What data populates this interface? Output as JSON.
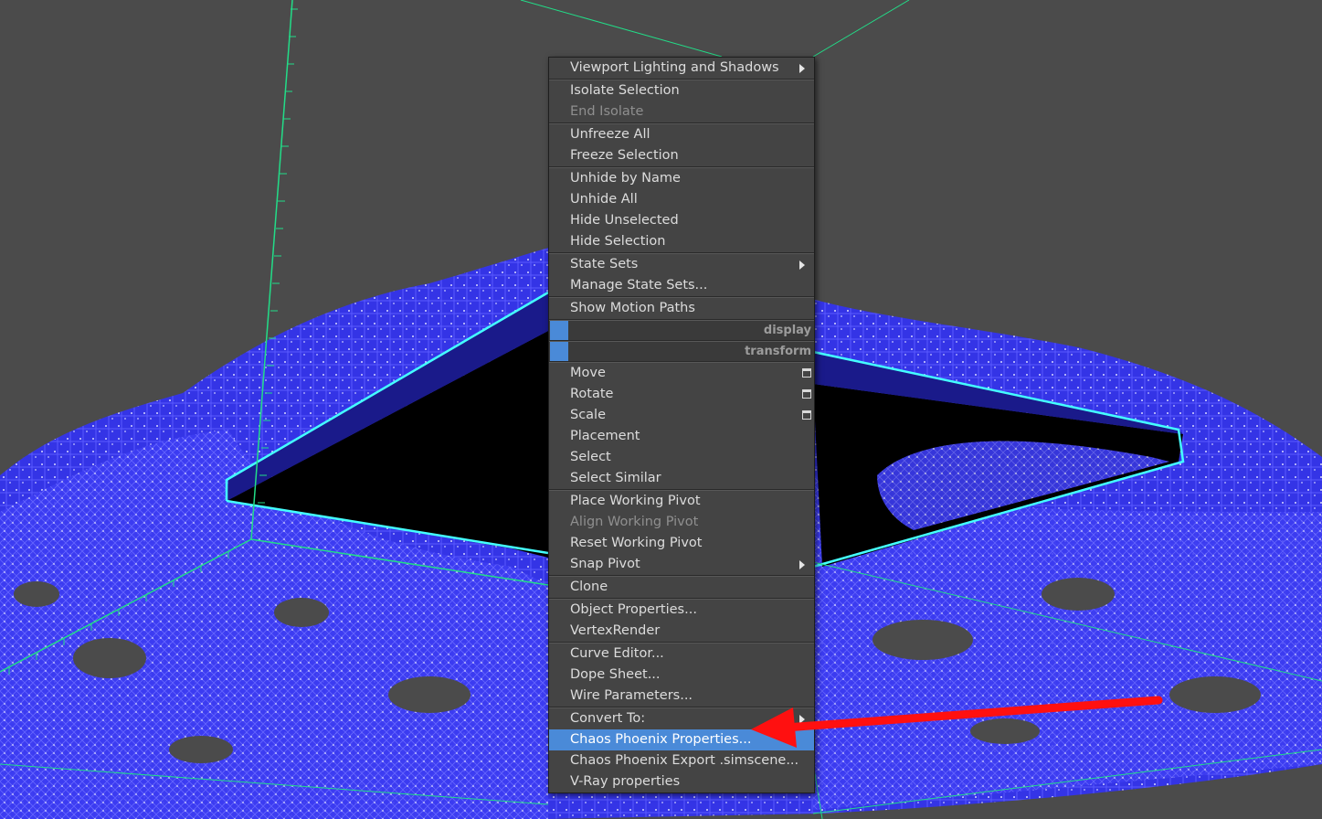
{
  "quad_menu": {
    "groups": [
      [
        {
          "label": "Viewport Lighting and Shadows",
          "submenu": true
        }
      ],
      [
        {
          "label": "Isolate Selection"
        },
        {
          "label": "End Isolate",
          "disabled": true
        }
      ],
      [
        {
          "label": "Unfreeze All"
        },
        {
          "label": "Freeze Selection"
        }
      ],
      [
        {
          "label": "Unhide by Name"
        },
        {
          "label": "Unhide All"
        },
        {
          "label": "Hide Unselected"
        },
        {
          "label": "Hide Selection"
        }
      ],
      [
        {
          "label": "State Sets",
          "submenu": true
        },
        {
          "label": "Manage State Sets..."
        }
      ],
      [
        {
          "label": "Show Motion Paths"
        }
      ]
    ],
    "quadrant_labels": [
      "display",
      "transform"
    ],
    "groups_after": [
      [
        {
          "label": "Move",
          "option_box": true
        },
        {
          "label": "Rotate",
          "option_box": true
        },
        {
          "label": "Scale",
          "option_box": true
        },
        {
          "label": "Placement"
        },
        {
          "label": "Select"
        },
        {
          "label": "Select Similar"
        }
      ],
      [
        {
          "label": "Place Working Pivot"
        },
        {
          "label": "Align Working Pivot",
          "disabled": true
        },
        {
          "label": "Reset Working Pivot"
        },
        {
          "label": "Snap Pivot",
          "submenu": true
        }
      ],
      [
        {
          "label": "Clone"
        }
      ],
      [
        {
          "label": "Object Properties..."
        },
        {
          "label": "VertexRender"
        }
      ],
      [
        {
          "label": "Curve Editor..."
        },
        {
          "label": "Dope Sheet..."
        },
        {
          "label": "Wire Parameters..."
        }
      ],
      [
        {
          "label": "Convert To:",
          "submenu": true
        },
        {
          "label": "Chaos Phoenix Properties...",
          "highlighted": true
        },
        {
          "label": "Chaos Phoenix Export .simscene..."
        },
        {
          "label": "V-Ray properties"
        }
      ]
    ]
  },
  "colors": {
    "viewport_bg": "#4b4b4b",
    "mesh": "#3a3af0",
    "grid_green": "#22dd88",
    "highlight": "#4a8ad8",
    "annotation_arrow": "#ff1010"
  }
}
